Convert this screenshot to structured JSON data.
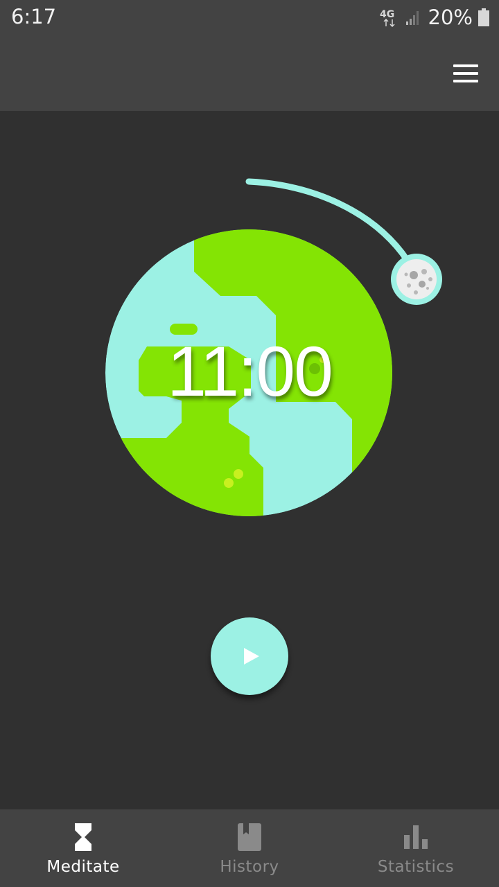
{
  "status_bar": {
    "time": "6:17",
    "network": "4G",
    "battery_percent": "20%",
    "battery_level": 0.2
  },
  "app_bar": {
    "menu_icon": "menu-icon"
  },
  "timer": {
    "value": "11:00"
  },
  "colors": {
    "background": "#303030",
    "bar": "#434343",
    "land": "#84e404",
    "water": "#9cf1e4",
    "accent": "#9cf1e4"
  },
  "controls": {
    "play_icon": "play-icon"
  },
  "bottom_nav": {
    "items": [
      {
        "label": "Meditate",
        "icon": "hourglass-icon",
        "active": true
      },
      {
        "label": "History",
        "icon": "book-icon",
        "active": false
      },
      {
        "label": "Statistics",
        "icon": "bar-chart-icon",
        "active": false
      }
    ]
  }
}
